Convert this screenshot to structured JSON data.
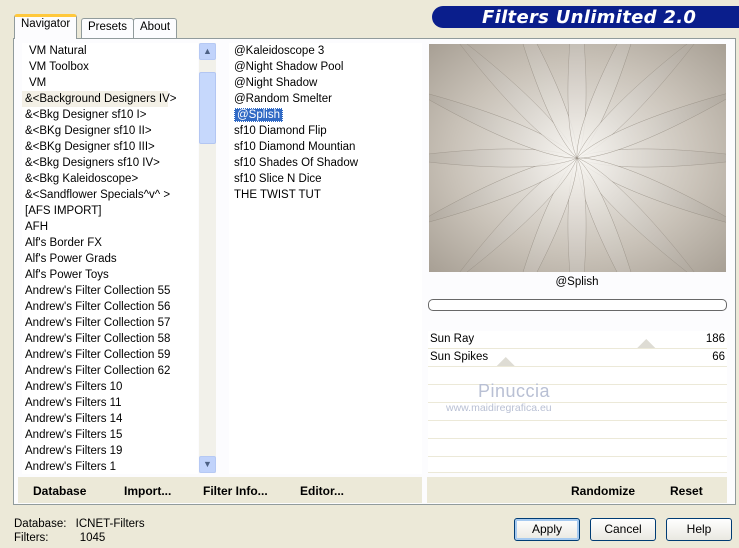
{
  "app": {
    "title": "Filters Unlimited 2.0"
  },
  "tabs": [
    {
      "label": "Navigator",
      "active": true
    },
    {
      "label": "Presets"
    },
    {
      "label": "About"
    }
  ],
  "categories": [
    "VM Natural",
    "VM Toolbox",
    "VM",
    "&<Background Designers IV>",
    "&<Bkg Designer sf10 I>",
    "&<BKg Designer sf10 II>",
    "&<BKg Designer sf10 III>",
    "&<Bkg Designers sf10 IV>",
    "&<Bkg Kaleidoscope>",
    "&<Sandflower Specials^v^ >",
    "[AFS IMPORT]",
    "AFH",
    "Alf's Border FX",
    "Alf's Power Grads",
    "Alf's Power Toys",
    "Andrew's Filter Collection 55",
    "Andrew's Filter Collection 56",
    "Andrew's Filter Collection 57",
    "Andrew's Filter Collection 58",
    "Andrew's Filter Collection 59",
    "Andrew's Filter Collection 62",
    "Andrew's Filters 10",
    "Andrew's Filters 11",
    "Andrew's Filters 14",
    "Andrew's Filters 15",
    "Andrew's Filters 19",
    "Andrew's Filters 1"
  ],
  "filters": [
    "@Kaleidoscope 3",
    "@Night Shadow Pool",
    "@Night Shadow",
    "@Random Smelter",
    "@Splish",
    "sf10 Diamond Flip",
    "sf10 Diamond Mountian",
    "sf10 Shades Of Shadow",
    "sf10 Slice N Dice",
    "THE TWIST TUT"
  ],
  "bottom_bar": {
    "database": "Database",
    "import": "Import...",
    "filter_info": "Filter Info...",
    "editor": "Editor...",
    "randomize": "Randomize",
    "reset": "Reset"
  },
  "preview": {
    "filter_name": "@Splish"
  },
  "params": [
    {
      "label": "Sun Ray",
      "value": "186",
      "level": 0.73
    },
    {
      "label": "Sun Spikes",
      "value": "66",
      "level": 0.26
    }
  ],
  "watermark": {
    "name": "Pinuccia",
    "url": "www.maidiregrafica.eu"
  },
  "status": {
    "db_label": "Database:",
    "db_value": "ICNET-Filters",
    "filters_label": "Filters:",
    "filters_value": "1045"
  },
  "buttons": {
    "apply": "Apply",
    "cancel": "Cancel",
    "help": "Help"
  },
  "colors": {
    "banner": "#0a1e8c",
    "selection": "#316ac5"
  }
}
